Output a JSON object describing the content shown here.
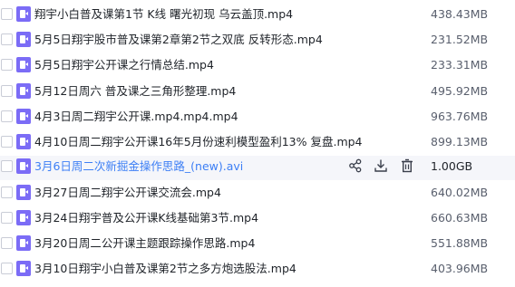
{
  "files": [
    {
      "name": "翔宇小白普及课第1节 K线 曙光初现 乌云盖顶.mp4",
      "size": "438.43MB"
    },
    {
      "name": "5月5日翔宇股市普及课第2章第2节之双底 反转形态.mp4",
      "size": "231.52MB"
    },
    {
      "name": "5月5日翔宇公开课之行情总结.mp4",
      "size": "233.31MB"
    },
    {
      "name": "5月12日周六 普及课之三角形整理.mp4",
      "size": "495.92MB"
    },
    {
      "name": "4月3日周二翔宇公开课.mp4.mp4.mp4",
      "size": "963.76MB"
    },
    {
      "name": "4月10日周二翔宇公开课16年5月份速利模型盈利13% 复盘.mp4",
      "size": "899.13MB"
    },
    {
      "name": "3月6日周二次新掘金操作思路_(new).avi",
      "size": "1.00GB"
    },
    {
      "name": "3月27日周二翔宇公开课交流会.mp4",
      "size": "640.02MB"
    },
    {
      "name": "3月24日翔宇普及公开课K线基础第3节.mp4",
      "size": "660.63MB"
    },
    {
      "name": "3月20日周二公开课主题跟踪操作思路.mp4",
      "size": "551.88MB"
    },
    {
      "name": "3月10日翔宇小白普及课第2节之多方炮选股法.mp4",
      "size": "403.96MB"
    }
  ],
  "hover_actions": {
    "share_icon": "share-icon",
    "download_icon": "download-icon",
    "delete_icon": "trash-icon"
  },
  "colors": {
    "file_icon": "#7b6cf6",
    "hover_text": "#3d7ff5",
    "hover_background": "#f5f6fa"
  }
}
